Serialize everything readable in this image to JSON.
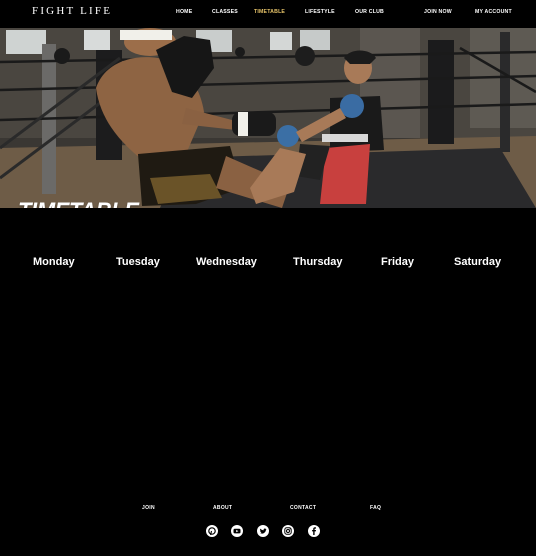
{
  "header": {
    "brand": "FIGHT LIFE",
    "nav": [
      "HOME",
      "CLASSES",
      "TIMETABLE",
      "LIFESTYLE",
      "OUR CLUB"
    ],
    "active": "TIMETABLE",
    "join": "JOIN NOW",
    "account": "MY ACCOUNT"
  },
  "hero": {
    "title": "TIMETABLE"
  },
  "days": [
    "Monday",
    "Tuesday",
    "Wednesday",
    "Thursday",
    "Friday",
    "Saturday"
  ],
  "footer": {
    "links": [
      "JOIN",
      "ABOUT",
      "CONTACT",
      "FAQ"
    ],
    "social": [
      "pinterest-icon",
      "youtube-icon",
      "twitter-icon",
      "instagram-icon",
      "facebook-icon"
    ]
  },
  "colors": {
    "active_nav": "#e8c56a",
    "background": "#000000"
  }
}
